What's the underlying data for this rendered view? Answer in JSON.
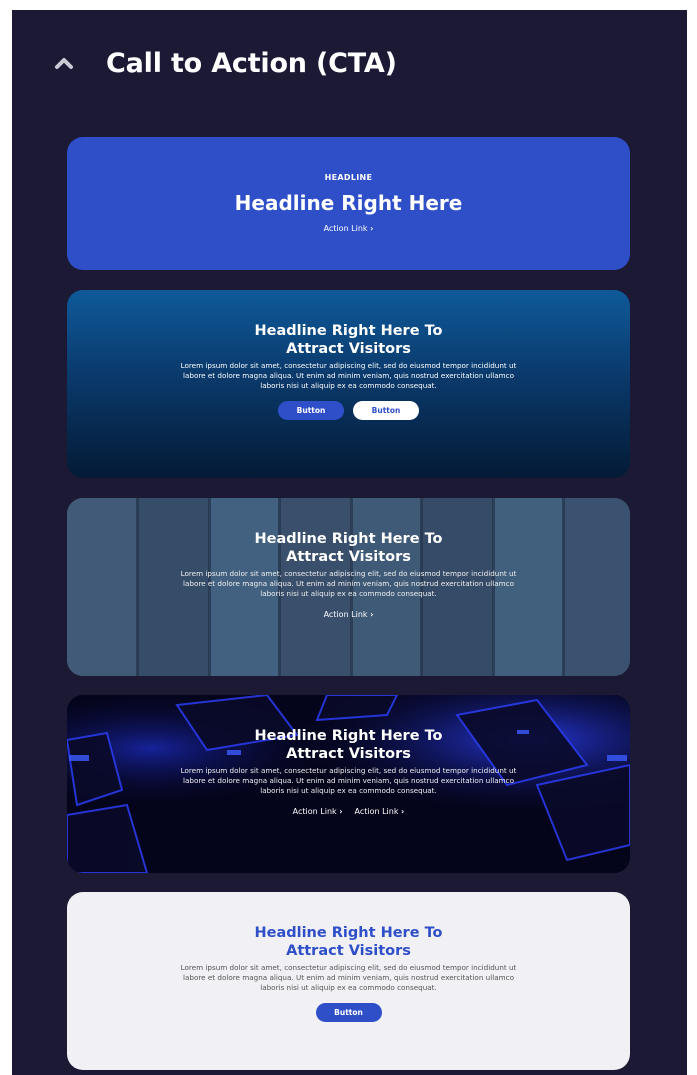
{
  "section": {
    "title": "Call to Action (CTA)",
    "toggle_icon": "chevron-up-icon"
  },
  "colors": {
    "panel_bg": "#1b1934",
    "accent_blue": "#2f4fc9",
    "light_card_bg": "#f1f1f5"
  },
  "cards": [
    {
      "eyebrow": "HEADLINE",
      "headline": "Headline Right Here",
      "action_link": "Action Link",
      "chevron": "›"
    },
    {
      "headline_line1": "Headline Right Here To",
      "headline_line2": "Attract Visitors",
      "body": "Lorem ipsum dolor sit amet, consectetur adipiscing elit, sed do eiusmod tempor incididunt ut labore et dolore magna aliqua. Ut enim ad minim veniam, quis nostrud exercitation ullamco laboris nisi ut aliquip ex ea commodo consequat.",
      "button_primary": "Button",
      "button_secondary": "Button"
    },
    {
      "headline_line1": "Headline Right Here To",
      "headline_line2": "Attract Visitors",
      "body": "Lorem ipsum dolor sit amet, consectetur adipiscing elit, sed do eiusmod tempor incididunt ut labore et dolore magna aliqua. Ut enim ad minim veniam, quis nostrud exercitation ullamco laboris nisi ut aliquip ex ea commodo consequat.",
      "action_link": "Action Link",
      "chevron": "›"
    },
    {
      "headline_line1": "Headline Right Here To",
      "headline_line2": "Attract Visitors",
      "body": "Lorem ipsum dolor sit amet, consectetur adipiscing elit, sed do eiusmod tempor incididunt ut labore et dolore magna aliqua. Ut enim ad minim veniam, quis nostrud exercitation ullamco laboris nisi ut aliquip ex ea commodo consequat.",
      "action_link_1": "Action Link",
      "action_link_2": "Action Link",
      "chevron": "›"
    },
    {
      "headline_line1": "Headline Right Here To",
      "headline_line2": "Attract Visitors",
      "body": "Lorem ipsum dolor sit amet, consectetur adipiscing elit, sed do eiusmod tempor incididunt ut labore et dolore magna aliqua. Ut enim ad minim veniam, quis nostrud exercitation ullamco laboris nisi ut aliquip ex ea commodo consequat.",
      "button_primary": "Button"
    }
  ]
}
